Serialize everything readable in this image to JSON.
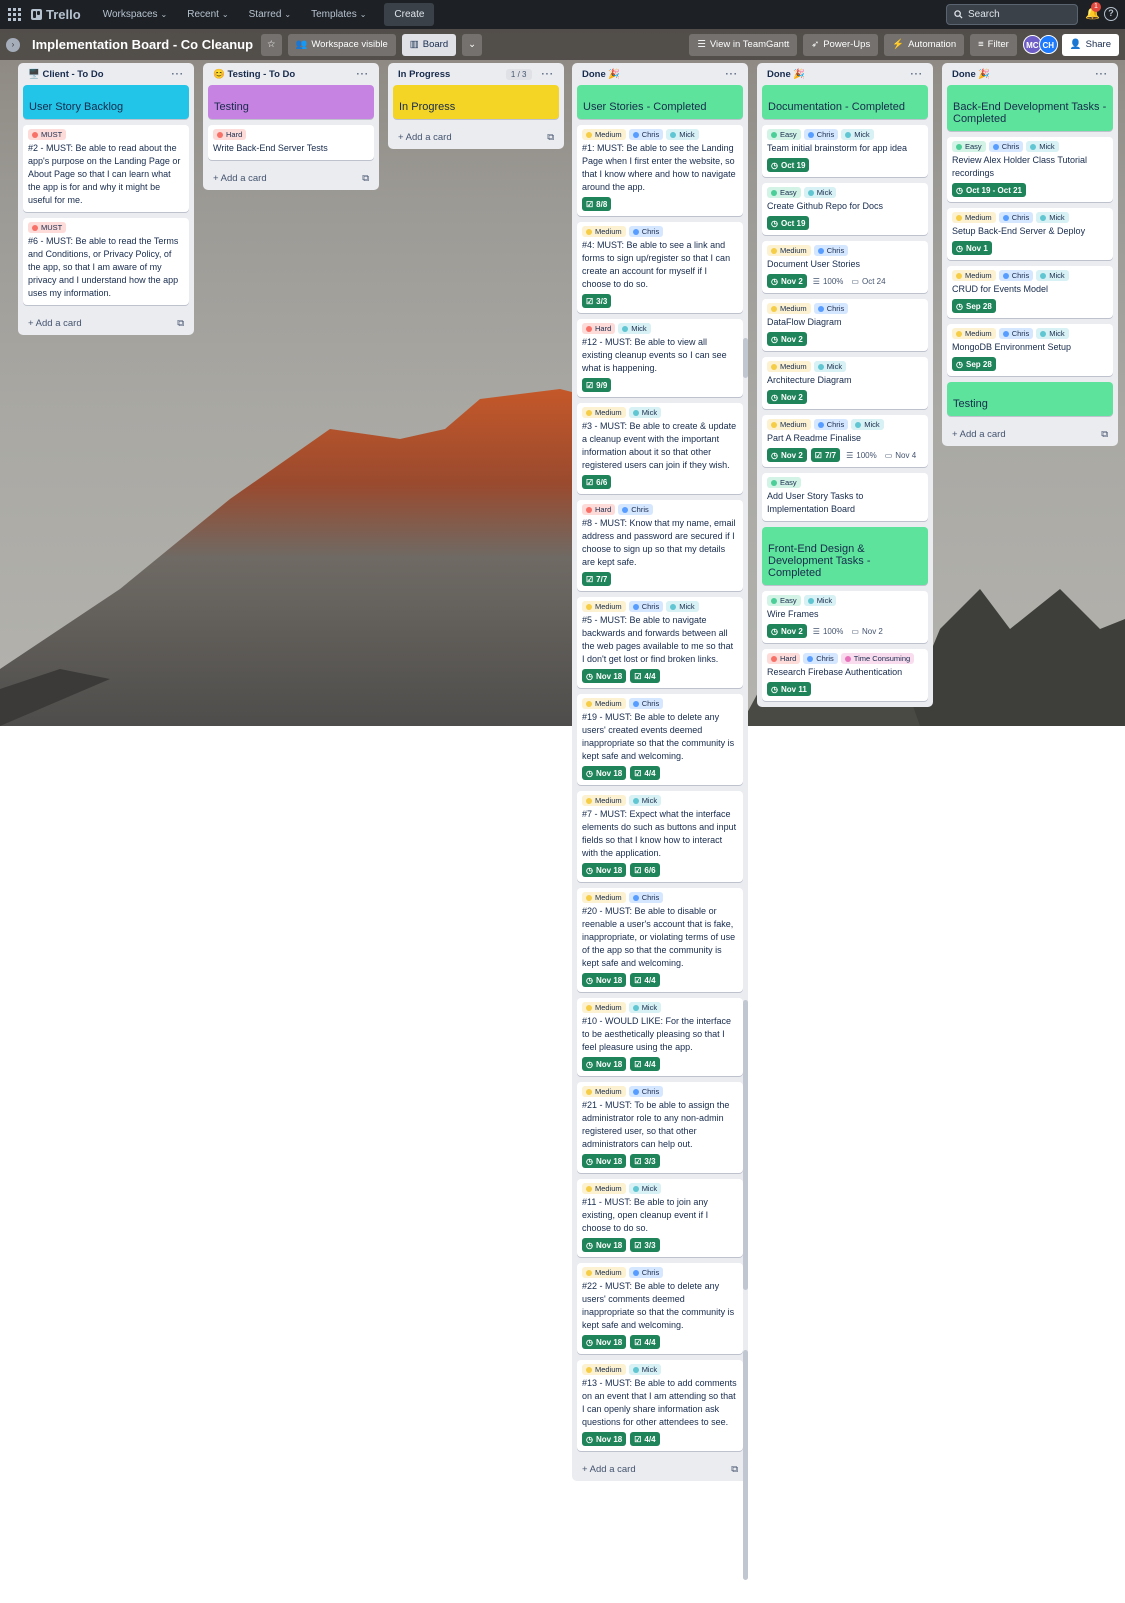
{
  "topbar": {
    "logo": "Trello",
    "workspaces": "Workspaces",
    "recent": "Recent",
    "starred": "Starred",
    "templates": "Templates",
    "create": "Create",
    "search_placeholder": "Search",
    "notifications_count": "1"
  },
  "board": {
    "title": "Implementation Board - Co Cleanup",
    "visibility": "Workspace visible",
    "view": "Board",
    "teamgantt": "View in TeamGantt",
    "powerups": "Power-Ups",
    "automation": "Automation",
    "filter": "Filter",
    "members": [
      "MC",
      "CH"
    ],
    "share": "Share"
  },
  "label_colors": {
    "MUST": "#f87168",
    "Hard": "#f87168",
    "Medium": "#f5cd47",
    "Easy": "#4bce97",
    "Chris": "#579dff",
    "Mick": "#60c6d2",
    "Time Consuming": "#e774bb"
  },
  "lists": [
    {
      "title": "🖥️ Client - To Do",
      "add": "Add a card",
      "cards": [
        {
          "cover": "#22c5e8",
          "title": "User Story Backlog"
        },
        {
          "labels": [
            "MUST"
          ],
          "title": "#2 - MUST: Be able to read about the app's purpose on the Landing Page or About Page so that I can learn what the app is for and why it might be useful for me."
        },
        {
          "labels": [
            "MUST"
          ],
          "title": "#6 - MUST: Be able to read the Terms and Conditions, or Privacy Policy, of the app, so that I am aware of my privacy and I understand how the app uses my information."
        }
      ]
    },
    {
      "title": "😊 Testing - To Do",
      "add": "Add a card",
      "cards": [
        {
          "cover": "#c783e2",
          "title": "Testing"
        },
        {
          "labels": [
            "Hard"
          ],
          "title": "Write Back-End Server Tests"
        }
      ]
    },
    {
      "title": "In Progress",
      "count": "1 / 3",
      "add": "Add a card",
      "cards": [
        {
          "cover": "#f4d526",
          "title": "In Progress"
        }
      ]
    },
    {
      "title": "Done 🎉",
      "add": "Add a card",
      "cards": [
        {
          "cover": "#5de39b",
          "title": "User Stories - Completed"
        },
        {
          "labels": [
            "Medium",
            "Chris",
            "Mick"
          ],
          "title": "#1: MUST: Be able to see the Landing Page when I first enter the website, so that I know where and how to navigate around the app.",
          "badges": [
            {
              "type": "check",
              "text": "8/8"
            }
          ]
        },
        {
          "labels": [
            "Medium",
            "Chris"
          ],
          "title": "#4: MUST: Be able to see a link and forms to sign up/register so that I can create an account for myself if I choose to do so.",
          "badges": [
            {
              "type": "check",
              "text": "3/3"
            }
          ]
        },
        {
          "labels": [
            "Hard",
            "Mick"
          ],
          "title": "#12 - MUST: Be able to view all existing cleanup events so I can see what is happening.",
          "badges": [
            {
              "type": "check",
              "text": "9/9"
            }
          ]
        },
        {
          "labels": [
            "Medium",
            "Mick"
          ],
          "title": "#3 - MUST: Be able to create & update a cleanup event with the important information about it so that other registered users can join if they wish.",
          "badges": [
            {
              "type": "check",
              "text": "6/6"
            }
          ]
        },
        {
          "labels": [
            "Hard",
            "Chris"
          ],
          "title": "#8 - MUST: Know that my name, email address and password are secured if I choose to sign up so that my details are kept safe.",
          "badges": [
            {
              "type": "check",
              "text": "7/7"
            }
          ]
        },
        {
          "labels": [
            "Medium",
            "Chris",
            "Mick"
          ],
          "title": "#5 - MUST: Be able to navigate backwards and forwards between all the web pages available to me so that I don't get lost or find broken links.",
          "badges": [
            {
              "type": "date",
              "text": "Nov 18"
            },
            {
              "type": "check",
              "text": "4/4"
            }
          ]
        },
        {
          "labels": [
            "Medium",
            "Chris"
          ],
          "title": "#19 - MUST: Be able to delete any users' created events deemed inappropriate so that the community is kept safe and welcoming.",
          "badges": [
            {
              "type": "date",
              "text": "Nov 18"
            },
            {
              "type": "check",
              "text": "4/4"
            }
          ]
        },
        {
          "labels": [
            "Medium",
            "Mick"
          ],
          "title": "#7 - MUST: Expect what the interface elements do such as buttons and input fields so that I know how to interact with the application.",
          "badges": [
            {
              "type": "date",
              "text": "Nov 18"
            },
            {
              "type": "check",
              "text": "6/6"
            }
          ]
        },
        {
          "labels": [
            "Medium",
            "Chris"
          ],
          "title": "#20 - MUST: Be able to disable or reenable a user's account that is fake, inappropriate, or violating terms of use of the app so that the community is kept safe and welcoming.",
          "badges": [
            {
              "type": "date",
              "text": "Nov 18"
            },
            {
              "type": "check",
              "text": "4/4"
            }
          ]
        },
        {
          "labels": [
            "Medium",
            "Mick"
          ],
          "title": "#10 - WOULD LIKE: For the interface to be aesthetically pleasing so that I feel pleasure using the app.",
          "badges": [
            {
              "type": "date",
              "text": "Nov 18"
            },
            {
              "type": "check",
              "text": "4/4"
            }
          ]
        },
        {
          "labels": [
            "Medium",
            "Chris"
          ],
          "title": "#21 - MUST: To be able to assign the administrator role to any non-admin registered user, so that other administrators can help out.",
          "badges": [
            {
              "type": "date",
              "text": "Nov 18"
            },
            {
              "type": "check",
              "text": "3/3"
            }
          ]
        },
        {
          "labels": [
            "Medium",
            "Mick"
          ],
          "title": "#11 - MUST: Be able to join any existing, open cleanup event if I choose to do so.",
          "badges": [
            {
              "type": "date",
              "text": "Nov 18"
            },
            {
              "type": "check",
              "text": "3/3"
            }
          ]
        },
        {
          "labels": [
            "Medium",
            "Chris"
          ],
          "title": "#22 - MUST: Be able to delete any users' comments deemed inappropriate so that the community is kept safe and welcoming.",
          "badges": [
            {
              "type": "date",
              "text": "Nov 18"
            },
            {
              "type": "check",
              "text": "4/4"
            }
          ]
        },
        {
          "labels": [
            "Medium",
            "Mick"
          ],
          "title": "#13 - MUST: Be able to add comments on an event that I am attending so that I can openly share information ask questions for other attendees to see.",
          "badges": [
            {
              "type": "date",
              "text": "Nov 18"
            },
            {
              "type": "check",
              "text": "4/4"
            }
          ]
        }
      ]
    },
    {
      "title": "Done 🎉",
      "cards": [
        {
          "cover": "#5de39b",
          "title": "Documentation - Completed"
        },
        {
          "labels": [
            "Easy",
            "Chris",
            "Mick"
          ],
          "title": "Team initial brainstorm for app idea",
          "badges": [
            {
              "type": "date",
              "text": "Oct 19"
            }
          ]
        },
        {
          "labels": [
            "Easy",
            "Mick"
          ],
          "title": "Create Github Repo for Docs",
          "badges": [
            {
              "type": "date",
              "text": "Oct 19"
            }
          ]
        },
        {
          "labels": [
            "Medium",
            "Chris"
          ],
          "title": "Document User Stories",
          "badges": [
            {
              "type": "date",
              "text": "Nov 2"
            },
            {
              "type": "plain",
              "icon": "progress",
              "text": "100%"
            },
            {
              "type": "plain",
              "icon": "calendar",
              "text": "Oct 24"
            }
          ]
        },
        {
          "labels": [
            "Medium",
            "Chris"
          ],
          "title": "DataFlow Diagram",
          "badges": [
            {
              "type": "date",
              "text": "Nov 2"
            }
          ]
        },
        {
          "labels": [
            "Medium",
            "Mick"
          ],
          "title": "Architecture Diagram",
          "badges": [
            {
              "type": "date",
              "text": "Nov 2"
            }
          ]
        },
        {
          "labels": [
            "Medium",
            "Chris",
            "Mick"
          ],
          "title": "Part A Readme Finalise",
          "badges": [
            {
              "type": "date",
              "text": "Nov 2"
            },
            {
              "type": "check",
              "text": "7/7"
            },
            {
              "type": "plain",
              "icon": "progress",
              "text": "100%"
            },
            {
              "type": "plain",
              "icon": "calendar",
              "text": "Nov 4"
            }
          ]
        },
        {
          "labels": [
            "Easy"
          ],
          "title": "Add User Story Tasks to Implementation Board"
        },
        {
          "cover": "#5de39b",
          "title": "Front-End Design & Development Tasks - Completed"
        },
        {
          "labels": [
            "Easy",
            "Mick"
          ],
          "title": "Wire Frames",
          "badges": [
            {
              "type": "date",
              "text": "Nov 2"
            },
            {
              "type": "plain",
              "icon": "progress",
              "text": "100%"
            },
            {
              "type": "plain",
              "icon": "calendar",
              "text": "Nov 2"
            }
          ]
        },
        {
          "labels": [
            "Hard",
            "Chris",
            "Time Consuming"
          ],
          "title": "Research Firebase Authentication",
          "badges": [
            {
              "type": "date",
              "text": "Nov 11"
            }
          ]
        }
      ]
    },
    {
      "title": "Done 🎉",
      "add": "Add a card",
      "cards": [
        {
          "cover": "#5de39b",
          "title": "Back-End Development Tasks - Completed"
        },
        {
          "labels": [
            "Easy",
            "Chris",
            "Mick"
          ],
          "title": "Review Alex Holder Class Tutorial recordings",
          "badges": [
            {
              "type": "date",
              "text": "Oct 19 - Oct 21"
            }
          ]
        },
        {
          "labels": [
            "Medium",
            "Chris",
            "Mick"
          ],
          "title": "Setup Back-End Server & Deploy",
          "badges": [
            {
              "type": "date",
              "text": "Nov 1"
            }
          ]
        },
        {
          "labels": [
            "Medium",
            "Chris",
            "Mick"
          ],
          "title": "CRUD for Events Model",
          "badges": [
            {
              "type": "date",
              "text": "Sep 28"
            }
          ]
        },
        {
          "labels": [
            "Medium",
            "Chris",
            "Mick"
          ],
          "title": "MongoDB Environment Setup",
          "badges": [
            {
              "type": "date",
              "text": "Sep 28"
            }
          ]
        },
        {
          "cover": "#5de39b",
          "title": "Testing"
        }
      ]
    }
  ]
}
